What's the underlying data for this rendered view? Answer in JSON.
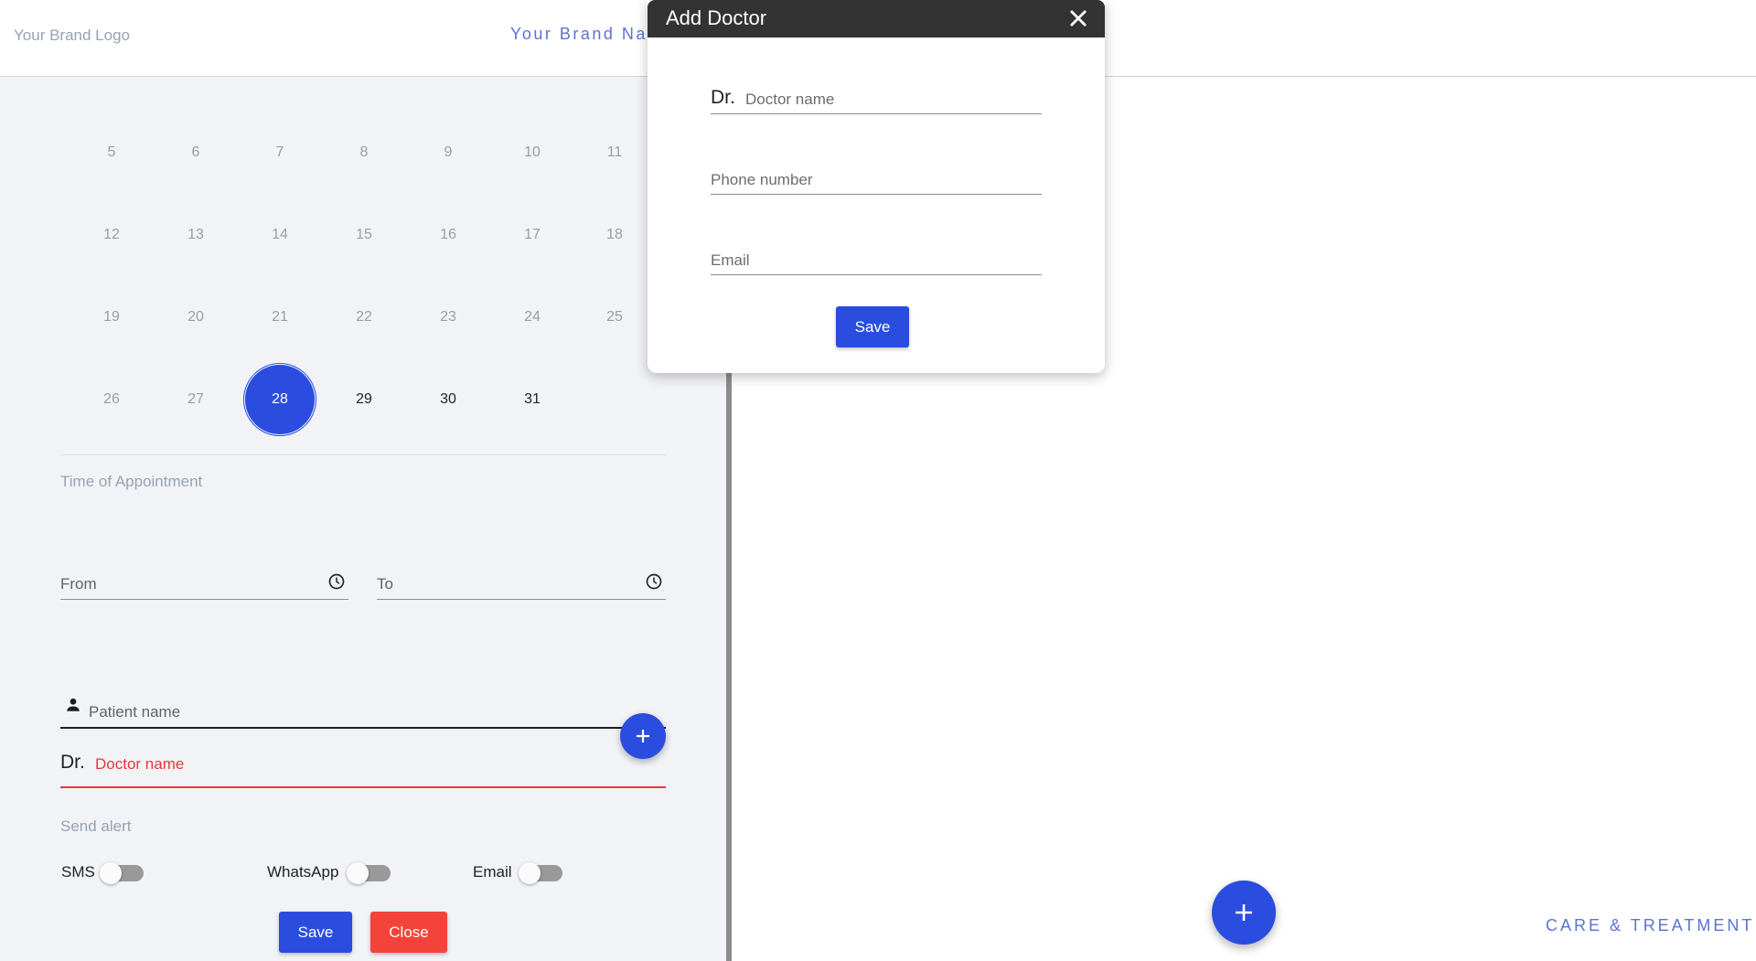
{
  "header": {
    "brand_logo": "Your Brand Logo",
    "brand_name": "Your Brand Name"
  },
  "calendar": {
    "weeks": [
      [
        {
          "d": "5",
          "s": "past"
        },
        {
          "d": "6",
          "s": "past"
        },
        {
          "d": "7",
          "s": "past"
        },
        {
          "d": "8",
          "s": "past"
        },
        {
          "d": "9",
          "s": "past"
        },
        {
          "d": "10",
          "s": "past"
        },
        {
          "d": "11",
          "s": "past"
        }
      ],
      [
        {
          "d": "12",
          "s": "past"
        },
        {
          "d": "13",
          "s": "past"
        },
        {
          "d": "14",
          "s": "past"
        },
        {
          "d": "15",
          "s": "past"
        },
        {
          "d": "16",
          "s": "past"
        },
        {
          "d": "17",
          "s": "past"
        },
        {
          "d": "18",
          "s": "past"
        }
      ],
      [
        {
          "d": "19",
          "s": "past"
        },
        {
          "d": "20",
          "s": "past"
        },
        {
          "d": "21",
          "s": "past"
        },
        {
          "d": "22",
          "s": "past"
        },
        {
          "d": "23",
          "s": "past"
        },
        {
          "d": "24",
          "s": "past"
        },
        {
          "d": "25",
          "s": "past"
        }
      ],
      [
        {
          "d": "26",
          "s": "past"
        },
        {
          "d": "27",
          "s": "past"
        },
        {
          "d": "28",
          "s": "selected"
        },
        {
          "d": "29",
          "s": "active"
        },
        {
          "d": "30",
          "s": "active"
        },
        {
          "d": "31",
          "s": "active"
        }
      ]
    ],
    "selected_day": "28"
  },
  "form": {
    "time_label": "Time of Appointment",
    "from_placeholder": "From",
    "to_placeholder": "To",
    "patient_placeholder": "Patient name",
    "dr_prefix": "Dr.",
    "doctor_placeholder": "Doctor name",
    "alert_label": "Send alert",
    "toggles": [
      {
        "label": "SMS",
        "on": false
      },
      {
        "label": "WhatsApp",
        "on": false
      },
      {
        "label": "Email",
        "on": false
      }
    ],
    "save_label": "Save",
    "close_label": "Close"
  },
  "footer": {
    "tagline": "CARE & TREATMENT"
  },
  "modal": {
    "title": "Add Doctor",
    "dr_prefix": "Dr.",
    "doctor_placeholder": "Doctor name",
    "phone_placeholder": "Phone number",
    "email_placeholder": "Email",
    "save_label": "Save"
  },
  "colors": {
    "primary": "#2a4de0",
    "danger": "#f4433a",
    "brand_text": "#5b72d6",
    "modal_header": "#333333"
  }
}
